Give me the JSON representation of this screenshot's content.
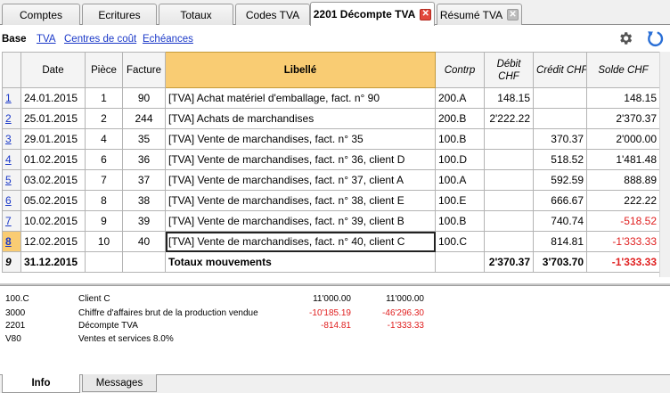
{
  "tabs": [
    {
      "label": "Comptes"
    },
    {
      "label": "Ecritures"
    },
    {
      "label": "Totaux"
    },
    {
      "label": "Codes TVA"
    },
    {
      "label": "2201 Décompte TVA"
    },
    {
      "label": "Résumé TVA"
    }
  ],
  "toolbar": {
    "view_label": "Base",
    "links": [
      "TVA",
      "Centres de coût",
      "Echéances"
    ],
    "settings_icon": "gear-icon",
    "refresh_icon": "refresh-icon"
  },
  "table": {
    "headers": {
      "date": "Date",
      "piece": "Pièce",
      "facture": "Facture",
      "libelle": "Libellé",
      "contrp": "Contrp",
      "debit_1": "Débit",
      "debit_2": "CHF",
      "credit": "Crédit CHF",
      "solde": "Solde CHF"
    },
    "rows": [
      {
        "num": "1",
        "date": "24.01.2015",
        "piece": "1",
        "facture": "90",
        "libelle": "[TVA] Achat matériel d'emballage, fact. n° 90",
        "contrp": "200.A",
        "debit": "148.15",
        "credit": "",
        "solde": "148.15"
      },
      {
        "num": "2",
        "date": "25.01.2015",
        "piece": "2",
        "facture": "244",
        "libelle": "[TVA] Achats de marchandises",
        "contrp": "200.B",
        "debit": "2'222.22",
        "credit": "",
        "solde": "2'370.37"
      },
      {
        "num": "3",
        "date": "29.01.2015",
        "piece": "4",
        "facture": "35",
        "libelle": "[TVA] Vente de marchandises, fact. n° 35",
        "contrp": "100.B",
        "debit": "",
        "credit": "370.37",
        "solde": "2'000.00"
      },
      {
        "num": "4",
        "date": "01.02.2015",
        "piece": "6",
        "facture": "36",
        "libelle": "[TVA] Vente de marchandises, fact. n° 36, client D",
        "contrp": "100.D",
        "debit": "",
        "credit": "518.52",
        "solde": "1'481.48"
      },
      {
        "num": "5",
        "date": "03.02.2015",
        "piece": "7",
        "facture": "37",
        "libelle": "[TVA] Vente de marchandises, fact. n° 37, client A",
        "contrp": "100.A",
        "debit": "",
        "credit": "592.59",
        "solde": "888.89"
      },
      {
        "num": "6",
        "date": "05.02.2015",
        "piece": "8",
        "facture": "38",
        "libelle": "[TVA] Vente de marchandises, fact. n° 38, client E",
        "contrp": "100.E",
        "debit": "",
        "credit": "666.67",
        "solde": "222.22"
      },
      {
        "num": "7",
        "date": "10.02.2015",
        "piece": "9",
        "facture": "39",
        "libelle": "[TVA] Vente de marchandises, fact. n° 39, client B",
        "contrp": "100.B",
        "debit": "",
        "credit": "740.74",
        "solde": "-518.52"
      },
      {
        "num": "8",
        "date": "12.02.2015",
        "piece": "10",
        "facture": "40",
        "libelle": "[TVA] Vente de marchandises, fact. n° 40, client C",
        "contrp": "100.C",
        "debit": "",
        "credit": "814.81",
        "solde": "-1'333.33"
      }
    ],
    "total": {
      "num": "9",
      "date": "31.12.2015",
      "libelle": "Totaux  mouvements",
      "debit": "2'370.37",
      "credit": "3'703.70",
      "solde": "-1'333.33"
    }
  },
  "info": {
    "rows": [
      {
        "account": "100.C",
        "description": "Client C",
        "value1": "11'000.00",
        "value2": "11'000.00"
      },
      {
        "account": "3000",
        "description": "Chiffre d'affaires brut de la production vendue",
        "value1": "-10'185.19",
        "value2": "-46'296.30"
      },
      {
        "account": "2201",
        "description": "Décompte TVA",
        "value1": "-814.81",
        "value2": "-1'333.33"
      },
      {
        "account": "V80",
        "description": "Ventes et services 8.0%",
        "value1": "",
        "value2": ""
      }
    ]
  },
  "bottom_tabs": [
    {
      "label": "Info"
    },
    {
      "label": "Messages"
    }
  ],
  "colors": {
    "active_header": "#f9cc73",
    "link": "#1a38c8",
    "negative": "#e02020"
  }
}
